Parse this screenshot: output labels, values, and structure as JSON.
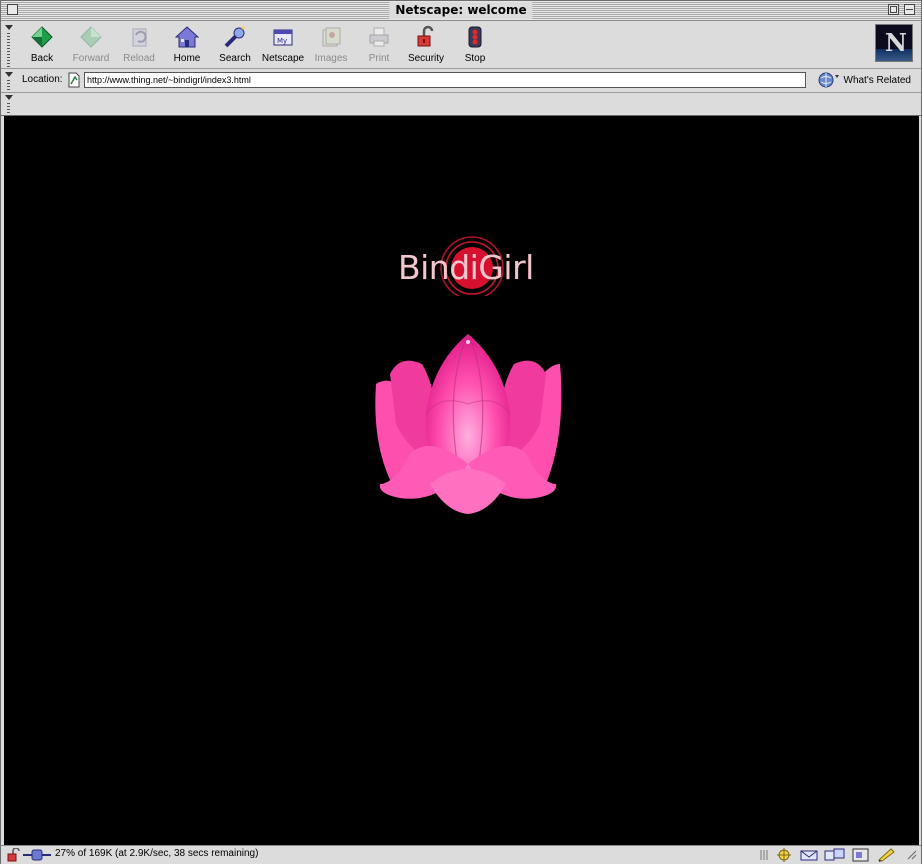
{
  "window": {
    "title": "Netscape: welcome"
  },
  "toolbar": {
    "buttons": [
      {
        "label": "Back",
        "icon": "back-arrow-icon",
        "enabled": true
      },
      {
        "label": "Forward",
        "icon": "forward-arrow-icon",
        "enabled": false
      },
      {
        "label": "Reload",
        "icon": "reload-icon",
        "enabled": false
      },
      {
        "label": "Home",
        "icon": "home-icon",
        "enabled": true
      },
      {
        "label": "Search",
        "icon": "search-icon",
        "enabled": true
      },
      {
        "label": "Netscape",
        "icon": "my-netscape-icon",
        "enabled": true
      },
      {
        "label": "Images",
        "icon": "images-icon",
        "enabled": false
      },
      {
        "label": "Print",
        "icon": "print-icon",
        "enabled": false
      },
      {
        "label": "Security",
        "icon": "security-lock-icon",
        "enabled": true
      },
      {
        "label": "Stop",
        "icon": "stop-icon",
        "enabled": true
      }
    ]
  },
  "location": {
    "label": "Location:",
    "url": "http://www.thing.net/~bindigrl/index3.html",
    "related_label": "What's Related"
  },
  "page": {
    "brand": "BindiGirl",
    "background": "#000000",
    "brand_text_color": "#f2c6cc",
    "bindi_color": "#d8102f",
    "lotus_color": "#ff4fae"
  },
  "status": {
    "text": "27% of 169K (at 2.9K/sec, 38 secs remaining)",
    "progress_fraction": 0.27
  }
}
